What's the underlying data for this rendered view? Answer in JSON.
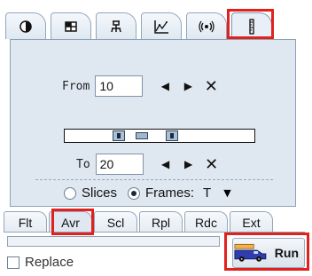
{
  "top_tabs": [
    {
      "icon": "contrast-icon"
    },
    {
      "icon": "grid-icon"
    },
    {
      "icon": "tool-icon"
    },
    {
      "icon": "chart-icon"
    },
    {
      "icon": "waves-icon"
    },
    {
      "icon": "ruler-icon",
      "selected": true
    }
  ],
  "panel": {
    "from_label": "From",
    "from_value": "10",
    "to_label": "To",
    "to_value": "20",
    "prev_glyph": "◀",
    "next_glyph": "▶",
    "clear_glyph": "✕",
    "slices_label": "Slices",
    "frames_label": "Frames:",
    "frames_mode": "T",
    "selected_option": "Frames"
  },
  "bottom_tabs": [
    {
      "label": "Flt"
    },
    {
      "label": "Avr",
      "selected": true
    },
    {
      "label": "Scl"
    },
    {
      "label": "Rpl"
    },
    {
      "label": "Rdc"
    },
    {
      "label": "Ext"
    }
  ],
  "replace_label": "Replace",
  "replace_checked": false,
  "run_label": "Run",
  "progress_fraction": 0,
  "colors": {
    "highlight": "#e2211c",
    "panel": "#dfe8f1"
  }
}
